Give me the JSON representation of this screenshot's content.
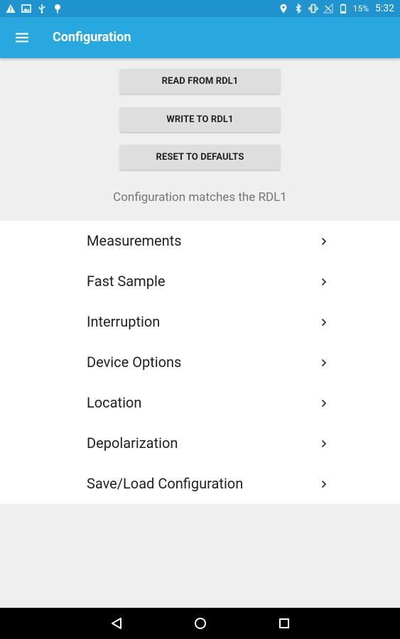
{
  "status_bar": {
    "battery": "15%",
    "time": "5:32",
    "icons": [
      "warning-icon",
      "photo-icon",
      "usb-icon",
      "pin-icon",
      "location-icon",
      "bluetooth-icon",
      "vibrate-icon",
      "no-signal-icon",
      "battery-icon"
    ]
  },
  "app_bar": {
    "title": "Configuration",
    "menu_icon": "hamburger-menu-icon",
    "background": "#29a8e0"
  },
  "actions": {
    "read": "READ FROM RDL1",
    "write": "WRITE TO RDL1",
    "reset": "RESET TO DEFAULTS"
  },
  "status_message": "Configuration matches the RDL1",
  "menu": {
    "items": [
      {
        "label": "Measurements"
      },
      {
        "label": "Fast Sample"
      },
      {
        "label": "Interruption"
      },
      {
        "label": "Device Options"
      },
      {
        "label": "Location"
      },
      {
        "label": "Depolarization"
      },
      {
        "label": "Save/Load Configuration"
      }
    ]
  },
  "nav_bar": {
    "buttons": [
      "back-icon",
      "home-icon",
      "recents-icon"
    ]
  }
}
